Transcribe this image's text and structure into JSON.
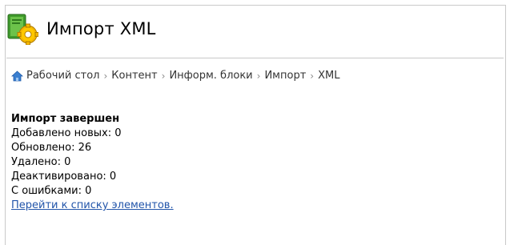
{
  "header": {
    "title": "Импорт XML",
    "icon": "xml-import-icon"
  },
  "breadcrumb": {
    "home_icon": "home-icon",
    "items": [
      "Рабочий стол",
      "Контент",
      "Информ. блоки",
      "Импорт",
      "XML"
    ],
    "separator": "›"
  },
  "result": {
    "heading": "Импорт завершен",
    "added": "Добавлено новых: 0",
    "updated": "Обновлено: 26",
    "deleted": "Удалено: 0",
    "deactivated": "Деактивировано: 0",
    "errors": "С ошибками: 0",
    "link": "Перейти к списку элементов."
  },
  "colors": {
    "link": "#2255aa",
    "icon_green": "#4a9a2a",
    "icon_gear": "#f0b400",
    "home_blue": "#3a7fd0"
  }
}
